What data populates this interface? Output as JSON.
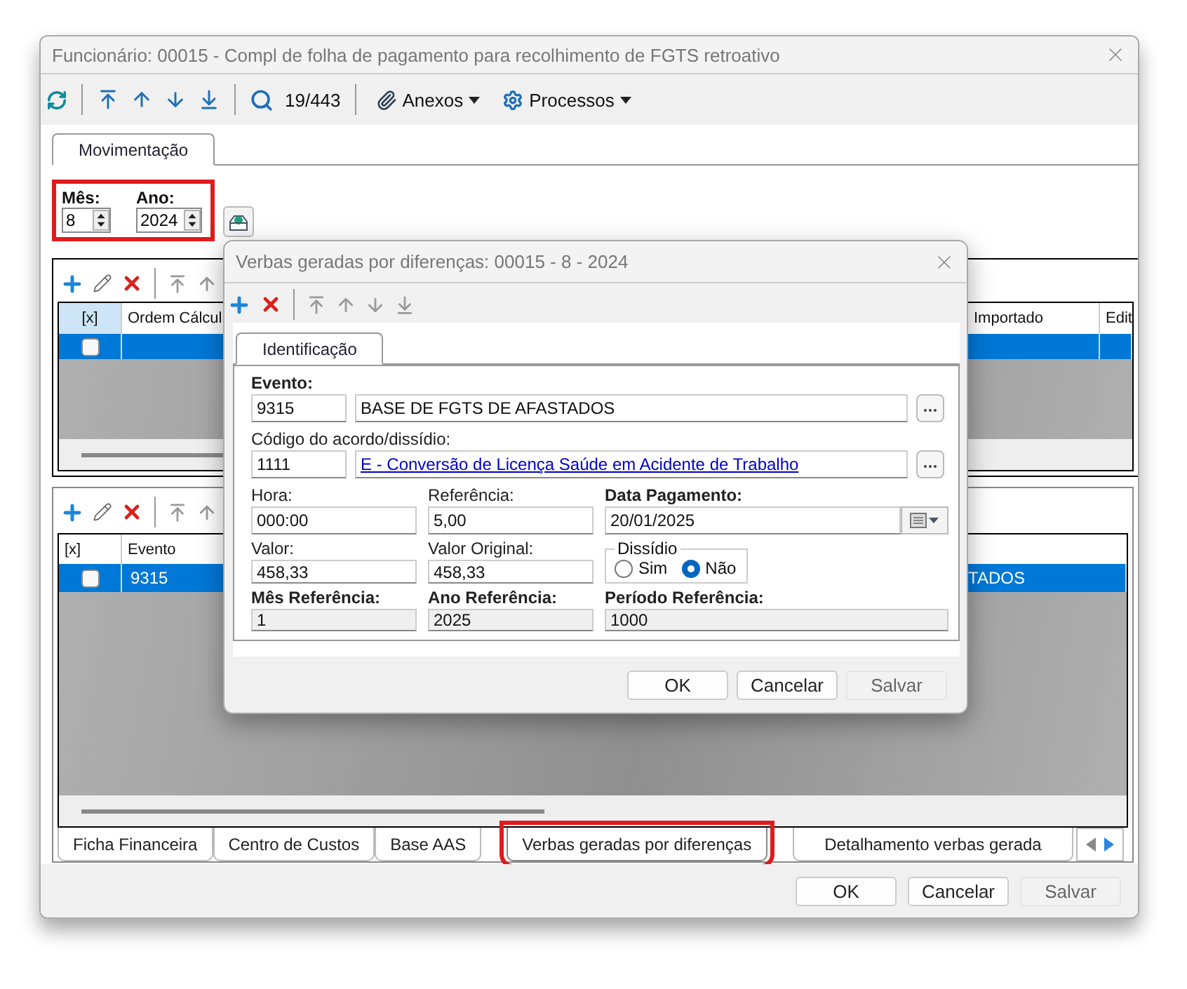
{
  "window": {
    "title": "Funcionário: 00015 - Compl de folha de pagamento para recolhimento de FGTS retroativo"
  },
  "toolbar": {
    "record_counter": "19/443",
    "menus": [
      {
        "label": "Anexos",
        "kind": "attach"
      },
      {
        "label": "Processos",
        "kind": "gear"
      }
    ]
  },
  "tabs": [
    {
      "label": "Movimentação",
      "selected": true
    }
  ],
  "period": {
    "month_label": "Mês:",
    "month": "8",
    "year_label": "Ano:",
    "year": "2024",
    "highlighted": true
  },
  "upper_grid": {
    "columns": [
      "[x]",
      "Ordem Cálcul",
      "Importado",
      "Edit"
    ],
    "rows": [
      {
        "checked": false,
        "selected": true
      }
    ]
  },
  "lower_grid": {
    "columns": [
      "[x]",
      "Evento"
    ],
    "rows": [
      {
        "checked": false,
        "selected": true,
        "evento": "9315",
        "column_3": "TADOS"
      }
    ]
  },
  "bottom_tabs": [
    {
      "label": "Ficha Financeira",
      "selected": false,
      "highlighted": false
    },
    {
      "label": "Centro de Custos",
      "selected": false,
      "highlighted": false
    },
    {
      "label": "Base AAS",
      "selected": false,
      "highlighted": false
    },
    {
      "label": "Verbas geradas por diferenças",
      "selected": true,
      "highlighted": true
    },
    {
      "label": "Detalhamento verbas gerada",
      "selected": false,
      "highlighted": false
    }
  ],
  "buttons": [
    {
      "label": "OK",
      "disabled": false
    },
    {
      "label": "Cancelar",
      "disabled": false
    },
    {
      "label": "Salvar",
      "disabled": true
    }
  ],
  "dialog": {
    "title": "Verbas geradas por diferenças: 00015 - 8 - 2024",
    "tabs": [
      {
        "label": "Identificação",
        "selected": true
      }
    ],
    "lookups": [
      {
        "label": "Evento:",
        "emphasized": true,
        "code": "9315",
        "description": "BASE DE FGTS DE AFASTADOS",
        "link": false
      },
      {
        "label": "Código do acordo/dissídio:",
        "emphasized": false,
        "code": "1111",
        "description": "E - Conversão de Licença Saúde em Acidente de Trabalho",
        "link": true
      }
    ],
    "fields": [
      {
        "kind": "text",
        "label": "Hora:",
        "emphasized": false,
        "value": "000:00",
        "readonly": false
      },
      {
        "kind": "text",
        "label": "Referência:",
        "emphasized": false,
        "value": "5,00",
        "readonly": false
      },
      {
        "kind": "date",
        "label": "Data Pagamento:",
        "emphasized": true,
        "value": "20/01/2025",
        "readonly": false
      },
      {
        "kind": "text",
        "label": "Valor:",
        "emphasized": false,
        "value": "458,33",
        "readonly": false
      },
      {
        "kind": "text",
        "label": "Valor Original:",
        "emphasized": false,
        "value": "458,33",
        "readonly": false
      },
      {
        "kind": "radio_group",
        "label": "Dissídio",
        "options": [
          {
            "label": "Sim",
            "selected": false
          },
          {
            "label": "Não",
            "selected": true
          }
        ]
      },
      {
        "kind": "text",
        "label": "Mês Referência:",
        "emphasized": true,
        "value": "1",
        "readonly": true
      },
      {
        "kind": "text",
        "label": "Ano Referência:",
        "emphasized": true,
        "value": "2025",
        "readonly": true
      },
      {
        "kind": "text",
        "label": "Período Referência:",
        "emphasized": true,
        "value": "1000",
        "readonly": true
      }
    ],
    "buttons": [
      {
        "label": "OK",
        "disabled": false
      },
      {
        "label": "Cancelar",
        "disabled": false
      },
      {
        "label": "Salvar",
        "disabled": true
      }
    ]
  }
}
